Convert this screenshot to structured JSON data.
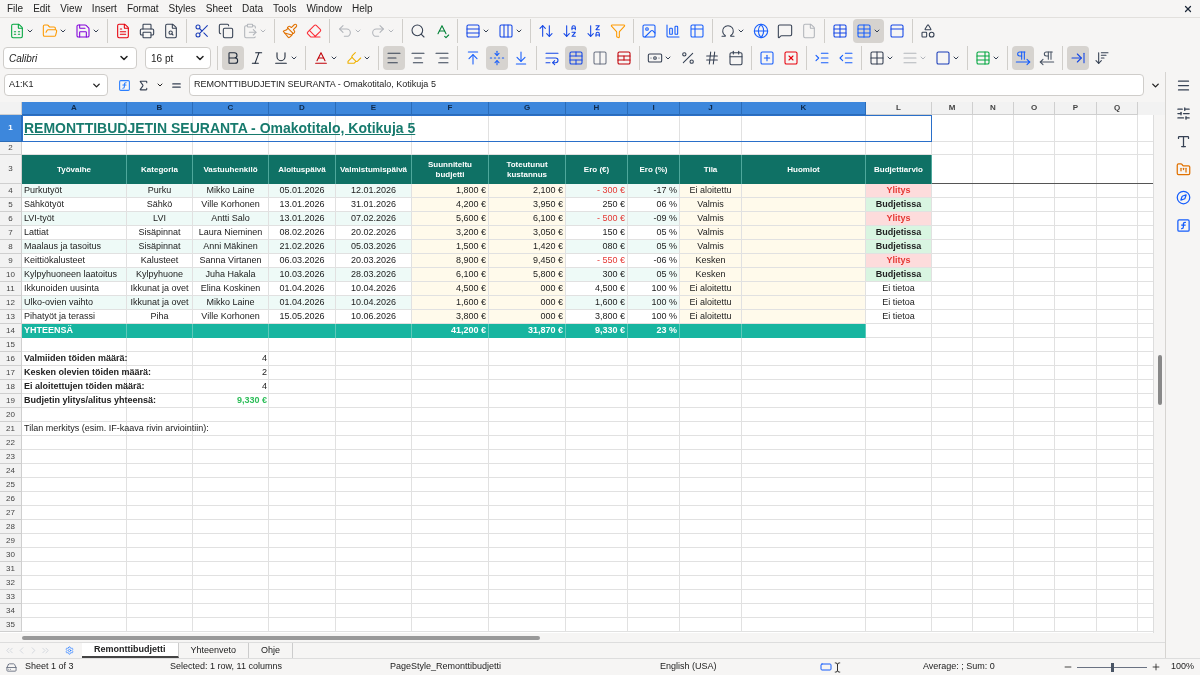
{
  "menu": [
    "File",
    "Edit",
    "View",
    "Insert",
    "Format",
    "Styles",
    "Sheet",
    "Data",
    "Tools",
    "Window",
    "Help"
  ],
  "standard_toolbar": [
    [
      {
        "kind": "new",
        "dropdown": true,
        "pressed": false,
        "disabled": false
      },
      {
        "kind": "open",
        "dropdown": true,
        "pressed": false,
        "disabled": false
      },
      {
        "kind": "save",
        "dropdown": true,
        "pressed": false,
        "disabled": false
      }
    ],
    [
      {
        "kind": "pdf",
        "dropdown": false,
        "pressed": false,
        "disabled": false
      },
      {
        "kind": "print",
        "dropdown": false,
        "pressed": false,
        "disabled": false
      },
      {
        "kind": "preview",
        "dropdown": false,
        "pressed": false,
        "disabled": false
      }
    ],
    [
      {
        "kind": "cut",
        "dropdown": false,
        "pressed": false,
        "disabled": false
      },
      {
        "kind": "copy",
        "dropdown": false,
        "pressed": false,
        "disabled": false
      },
      {
        "kind": "paste",
        "dropdown": true,
        "pressed": false,
        "disabled": true
      }
    ],
    [
      {
        "kind": "clone",
        "dropdown": false,
        "pressed": false,
        "disabled": false
      },
      {
        "kind": "clear",
        "dropdown": false,
        "pressed": false,
        "disabled": false
      }
    ],
    [
      {
        "kind": "undo",
        "dropdown": true,
        "pressed": false,
        "disabled": true
      },
      {
        "kind": "redo",
        "dropdown": true,
        "pressed": false,
        "disabled": true
      }
    ],
    [
      {
        "kind": "find",
        "dropdown": false,
        "pressed": false,
        "disabled": false
      },
      {
        "kind": "spell",
        "dropdown": false,
        "pressed": false,
        "disabled": false
      }
    ],
    [
      {
        "kind": "row",
        "dropdown": true,
        "pressed": false,
        "disabled": false
      },
      {
        "kind": "column",
        "dropdown": true,
        "pressed": false,
        "disabled": false
      }
    ],
    [
      {
        "kind": "sort",
        "dropdown": false,
        "pressed": false,
        "disabled": false
      },
      {
        "kind": "sort_asc",
        "dropdown": false,
        "pressed": false,
        "disabled": false
      },
      {
        "kind": "sort_desc",
        "dropdown": false,
        "pressed": false,
        "disabled": false
      },
      {
        "kind": "filter",
        "dropdown": false,
        "pressed": false,
        "disabled": false
      }
    ],
    [
      {
        "kind": "image",
        "dropdown": false,
        "pressed": false,
        "disabled": false
      },
      {
        "kind": "chart",
        "dropdown": false,
        "pressed": false,
        "disabled": false
      },
      {
        "kind": "pivot",
        "dropdown": false,
        "pressed": false,
        "disabled": false
      }
    ],
    [
      {
        "kind": "special",
        "dropdown": true,
        "pressed": false,
        "disabled": false
      },
      {
        "kind": "link",
        "dropdown": false,
        "pressed": false,
        "disabled": false
      },
      {
        "kind": "comment",
        "dropdown": false,
        "pressed": false,
        "disabled": false
      },
      {
        "kind": "header",
        "dropdown": false,
        "pressed": false,
        "disabled": true
      }
    ],
    [
      {
        "kind": "print_area",
        "dropdown": false,
        "pressed": false,
        "disabled": false
      },
      {
        "kind": "freeze",
        "dropdown": true,
        "pressed": true,
        "disabled": false
      },
      {
        "kind": "split",
        "dropdown": false,
        "pressed": false,
        "disabled": false
      }
    ],
    [
      {
        "kind": "shapes",
        "dropdown": false,
        "pressed": false,
        "disabled": false
      }
    ]
  ],
  "font_name": "Calibri",
  "font_size": "16 pt",
  "format_toolbar": [
    [
      {
        "kind": "bold",
        "dropdown": false,
        "pressed": true,
        "disabled": false
      },
      {
        "kind": "italic",
        "dropdown": false,
        "pressed": false,
        "disabled": false
      },
      {
        "kind": "underline",
        "dropdown": true,
        "pressed": false,
        "disabled": false
      }
    ],
    [
      {
        "kind": "font_color",
        "dropdown": true,
        "pressed": false,
        "disabled": false
      },
      {
        "kind": "highlight",
        "dropdown": true,
        "pressed": false,
        "disabled": false
      }
    ],
    [
      {
        "kind": "align_left",
        "dropdown": false,
        "pressed": true,
        "disabled": false
      },
      {
        "kind": "align_center",
        "dropdown": false,
        "pressed": false,
        "disabled": false
      },
      {
        "kind": "align_right",
        "dropdown": false,
        "pressed": false,
        "disabled": false
      }
    ],
    [
      {
        "kind": "top",
        "dropdown": false,
        "pressed": false,
        "disabled": false
      },
      {
        "kind": "middle",
        "dropdown": false,
        "pressed": true,
        "disabled": false
      },
      {
        "kind": "bottom",
        "dropdown": false,
        "pressed": false,
        "disabled": false
      }
    ],
    [
      {
        "kind": "wrap",
        "dropdown": false,
        "pressed": false,
        "disabled": false
      },
      {
        "kind": "merge_center",
        "dropdown": false,
        "pressed": true,
        "disabled": false
      },
      {
        "kind": "merge",
        "dropdown": false,
        "pressed": false,
        "disabled": false
      },
      {
        "kind": "unmerge",
        "dropdown": false,
        "pressed": false,
        "disabled": false
      }
    ],
    [
      {
        "kind": "currency",
        "dropdown": true,
        "pressed": false,
        "disabled": false
      },
      {
        "kind": "percent",
        "dropdown": false,
        "pressed": false,
        "disabled": false
      },
      {
        "kind": "number",
        "dropdown": false,
        "pressed": false,
        "disabled": false
      },
      {
        "kind": "date",
        "dropdown": false,
        "pressed": false,
        "disabled": false
      }
    ],
    [
      {
        "kind": "add_decimal",
        "dropdown": false,
        "pressed": false,
        "disabled": false
      },
      {
        "kind": "del_decimal",
        "dropdown": false,
        "pressed": false,
        "disabled": false
      }
    ],
    [
      {
        "kind": "indent_inc",
        "dropdown": false,
        "pressed": false,
        "disabled": false
      },
      {
        "kind": "indent_dec",
        "dropdown": false,
        "pressed": false,
        "disabled": false
      }
    ],
    [
      {
        "kind": "borders",
        "dropdown": true,
        "pressed": false,
        "disabled": false
      },
      {
        "kind": "border_style",
        "dropdown": true,
        "pressed": false,
        "disabled": true
      },
      {
        "kind": "border_color",
        "dropdown": true,
        "pressed": false,
        "disabled": false
      }
    ],
    [
      {
        "kind": "conditional",
        "dropdown": true,
        "pressed": false,
        "disabled": false
      }
    ],
    [
      {
        "kind": "ltr",
        "dropdown": false,
        "pressed": true,
        "disabled": false
      },
      {
        "kind": "rtl",
        "dropdown": false,
        "pressed": false,
        "disabled": false
      }
    ],
    [
      {
        "kind": "text_ltr",
        "dropdown": false,
        "pressed": true,
        "disabled": false
      },
      {
        "kind": "text_ttb",
        "dropdown": false,
        "pressed": false,
        "disabled": false
      }
    ]
  ],
  "name_box": "A1:K1",
  "formula": "REMONTTIBUDJETIN SEURANTA - Omakotitalo, Kotikuja 5",
  "columns": [
    {
      "label": "A",
      "selected": true
    },
    {
      "label": "B",
      "selected": true
    },
    {
      "label": "C",
      "selected": true
    },
    {
      "label": "D",
      "selected": true
    },
    {
      "label": "E",
      "selected": true
    },
    {
      "label": "F",
      "selected": true
    },
    {
      "label": "G",
      "selected": true
    },
    {
      "label": "H",
      "selected": true
    },
    {
      "label": "I",
      "selected": true
    },
    {
      "label": "J",
      "selected": true
    },
    {
      "label": "K",
      "selected": true
    },
    {
      "label": "L",
      "selected": false
    },
    {
      "label": "M",
      "selected": false
    },
    {
      "label": "N",
      "selected": false
    },
    {
      "label": "O",
      "selected": false
    },
    {
      "label": "P",
      "selected": false
    },
    {
      "label": "Q",
      "selected": false
    }
  ],
  "row_headers": [
    {
      "label": "1",
      "selected": true
    },
    {
      "label": "2",
      "selected": false
    },
    {
      "label": "3",
      "selected": false
    },
    {
      "label": "4",
      "selected": false
    },
    {
      "label": "5",
      "selected": false
    },
    {
      "label": "6",
      "selected": false
    },
    {
      "label": "7",
      "selected": false
    },
    {
      "label": "8",
      "selected": false
    },
    {
      "label": "9",
      "selected": false
    },
    {
      "label": "10",
      "selected": false
    },
    {
      "label": "11",
      "selected": false
    },
    {
      "label": "12",
      "selected": false
    },
    {
      "label": "13",
      "selected": false
    },
    {
      "label": "14",
      "selected": false
    },
    {
      "label": "15",
      "selected": false
    },
    {
      "label": "16",
      "selected": false
    },
    {
      "label": "17",
      "selected": false
    },
    {
      "label": "18",
      "selected": false
    },
    {
      "label": "19",
      "selected": false
    },
    {
      "label": "20",
      "selected": false
    },
    {
      "label": "21",
      "selected": false
    },
    {
      "label": "22",
      "selected": false
    },
    {
      "label": "23",
      "selected": false
    },
    {
      "label": "24",
      "selected": false
    },
    {
      "label": "25",
      "selected": false
    },
    {
      "label": "26",
      "selected": false
    },
    {
      "label": "27",
      "selected": false
    },
    {
      "label": "28",
      "selected": false
    },
    {
      "label": "29",
      "selected": false
    },
    {
      "label": "30",
      "selected": false
    },
    {
      "label": "31",
      "selected": false
    },
    {
      "label": "32",
      "selected": false
    },
    {
      "label": "33",
      "selected": false
    },
    {
      "label": "34",
      "selected": false
    },
    {
      "label": "35",
      "selected": false
    }
  ],
  "title": "REMONTTIBUDJETIN SEURANTA - Omakotitalo, Kotikuja 5",
  "table_headers": [
    "Työvaihe",
    "Kategoria",
    "Vastuuhenkilö",
    "Aloituspäivä",
    "Valmistumispäivä",
    "Suunniteltu budjetti",
    "Toteutunut kustannus",
    "Ero (€)",
    "Ero (%)",
    "Tila",
    "Huomiot",
    "Budjettiarvio"
  ],
  "table_rows": [
    {
      "task": "Purkutyöt",
      "category": "Purku",
      "owner": "Mikko Laine",
      "start": "05.01.2026",
      "end": "12.01.2026",
      "budget": "1,800 €",
      "actual": "2,100 €",
      "diff": {
        "text": "- 300 €",
        "kind": "over"
      },
      "pct": "-17 %",
      "status": "Ei aloitettu",
      "assessment": {
        "text": "Ylitys",
        "kind": "over"
      }
    },
    {
      "task": "Sähkötyöt",
      "category": "Sähkö",
      "owner": "Ville Korhonen",
      "start": "13.01.2026",
      "end": "31.01.2026",
      "budget": "4,200 €",
      "actual": "3,950 €",
      "diff": {
        "text": "250 €",
        "kind": "under"
      },
      "pct": "06 %",
      "status": "Valmis",
      "assessment": {
        "text": "Budjetissa",
        "kind": "under"
      }
    },
    {
      "task": "LVI-työt",
      "category": "LVI",
      "owner": "Antti Salo",
      "start": "13.01.2026",
      "end": "07.02.2026",
      "budget": "5,600 €",
      "actual": "6,100 €",
      "diff": {
        "text": "- 500 €",
        "kind": "over"
      },
      "pct": "-09 %",
      "status": "Valmis",
      "assessment": {
        "text": "Ylitys",
        "kind": "over"
      }
    },
    {
      "task": "Lattiat",
      "category": "Sisäpinnat",
      "owner": "Laura Nieminen",
      "start": "08.02.2026",
      "end": "20.02.2026",
      "budget": "3,200 €",
      "actual": "3,050 €",
      "diff": {
        "text": "150 €",
        "kind": "under"
      },
      "pct": "05 %",
      "status": "Valmis",
      "assessment": {
        "text": "Budjetissa",
        "kind": "under"
      }
    },
    {
      "task": "Maalaus ja tasoitus",
      "category": "Sisäpinnat",
      "owner": "Anni Mäkinen",
      "start": "21.02.2026",
      "end": "05.03.2026",
      "budget": "1,500 €",
      "actual": "1,420 €",
      "diff": {
        "text": "080 €",
        "kind": "under"
      },
      "pct": "05 %",
      "status": "Valmis",
      "assessment": {
        "text": "Budjetissa",
        "kind": "under"
      }
    },
    {
      "task": "Keittiökalusteet",
      "category": "Kalusteet",
      "owner": "Sanna Virtanen",
      "start": "06.03.2026",
      "end": "20.03.2026",
      "budget": "8,900 €",
      "actual": "9,450 €",
      "diff": {
        "text": "- 550 €",
        "kind": "over"
      },
      "pct": "-06 %",
      "status": "Kesken",
      "assessment": {
        "text": "Ylitys",
        "kind": "over"
      }
    },
    {
      "task": "Kylpyhuoneen laatoitus",
      "category": "Kylpyhuone",
      "owner": "Juha Hakala",
      "start": "10.03.2026",
      "end": "28.03.2026",
      "budget": "6,100 €",
      "actual": "5,800 €",
      "diff": {
        "text": "300 €",
        "kind": "under"
      },
      "pct": "05 %",
      "status": "Kesken",
      "assessment": {
        "text": "Budjetissa",
        "kind": "under"
      }
    },
    {
      "task": "Ikkunoiden uusinta",
      "category": "Ikkunat ja ovet",
      "owner": "Elina Koskinen",
      "start": "01.04.2026",
      "end": "10.04.2026",
      "budget": "4,500 €",
      "actual": "000 €",
      "diff": {
        "text": "4,500 €",
        "kind": "under"
      },
      "pct": "100 %",
      "status": "Ei aloitettu",
      "assessment": {
        "text": "Ei tietoa",
        "kind": "none"
      }
    },
    {
      "task": "Ulko-ovien vaihto",
      "category": "Ikkunat ja ovet",
      "owner": "Mikko Laine",
      "start": "01.04.2026",
      "end": "10.04.2026",
      "budget": "1,600 €",
      "actual": "000 €",
      "diff": {
        "text": "1,600 €",
        "kind": "under"
      },
      "pct": "100 %",
      "status": "Ei aloitettu",
      "assessment": {
        "text": "Ei tietoa",
        "kind": "none"
      }
    },
    {
      "task": "Pihatyöt ja terassi",
      "category": "Piha",
      "owner": "Ville Korhonen",
      "start": "15.05.2026",
      "end": "10.06.2026",
      "budget": "3,800 €",
      "actual": "000 €",
      "diff": {
        "text": "3,800 €",
        "kind": "under"
      },
      "pct": "100 %",
      "status": "Ei aloitettu",
      "assessment": {
        "text": "Ei tietoa",
        "kind": "none"
      }
    }
  ],
  "total": {
    "label": "YHTEENSÄ",
    "budget": "41,200 €",
    "actual": "31,870 €",
    "diff": "9,330 €",
    "pct": "23 %"
  },
  "summary": [
    {
      "label": "Valmiiden töiden määrä:",
      "value": "4",
      "kind": "plain"
    },
    {
      "label": "Kesken olevien töiden määrä:",
      "value": "2",
      "kind": "plain"
    },
    {
      "label": "Ei aloitettujen töiden määrä:",
      "value": "4",
      "kind": "plain"
    },
    {
      "label": "Budjetin ylitys/alitus yhteensä:",
      "value": "9,330 €",
      "kind": "positive"
    }
  ],
  "note": "Tilan merkitys (esim. IF-kaava rivin arviointiin):",
  "sheet_tabs": [
    {
      "label": "Remonttibudjetti",
      "selected": true
    },
    {
      "label": "Yhteenveto",
      "selected": false
    },
    {
      "label": "Ohje",
      "selected": false
    }
  ],
  "status_bar": {
    "sheet": "Sheet 1 of 3",
    "selection": "Selected: 1 row, 11 columns",
    "page_style": "PageStyle_Remonttibudjetti",
    "language": "English (USA)",
    "sum": "Average: ; Sum: 0",
    "zoom_slider": {
      "level": 0.5
    },
    "zoom": "100%"
  }
}
